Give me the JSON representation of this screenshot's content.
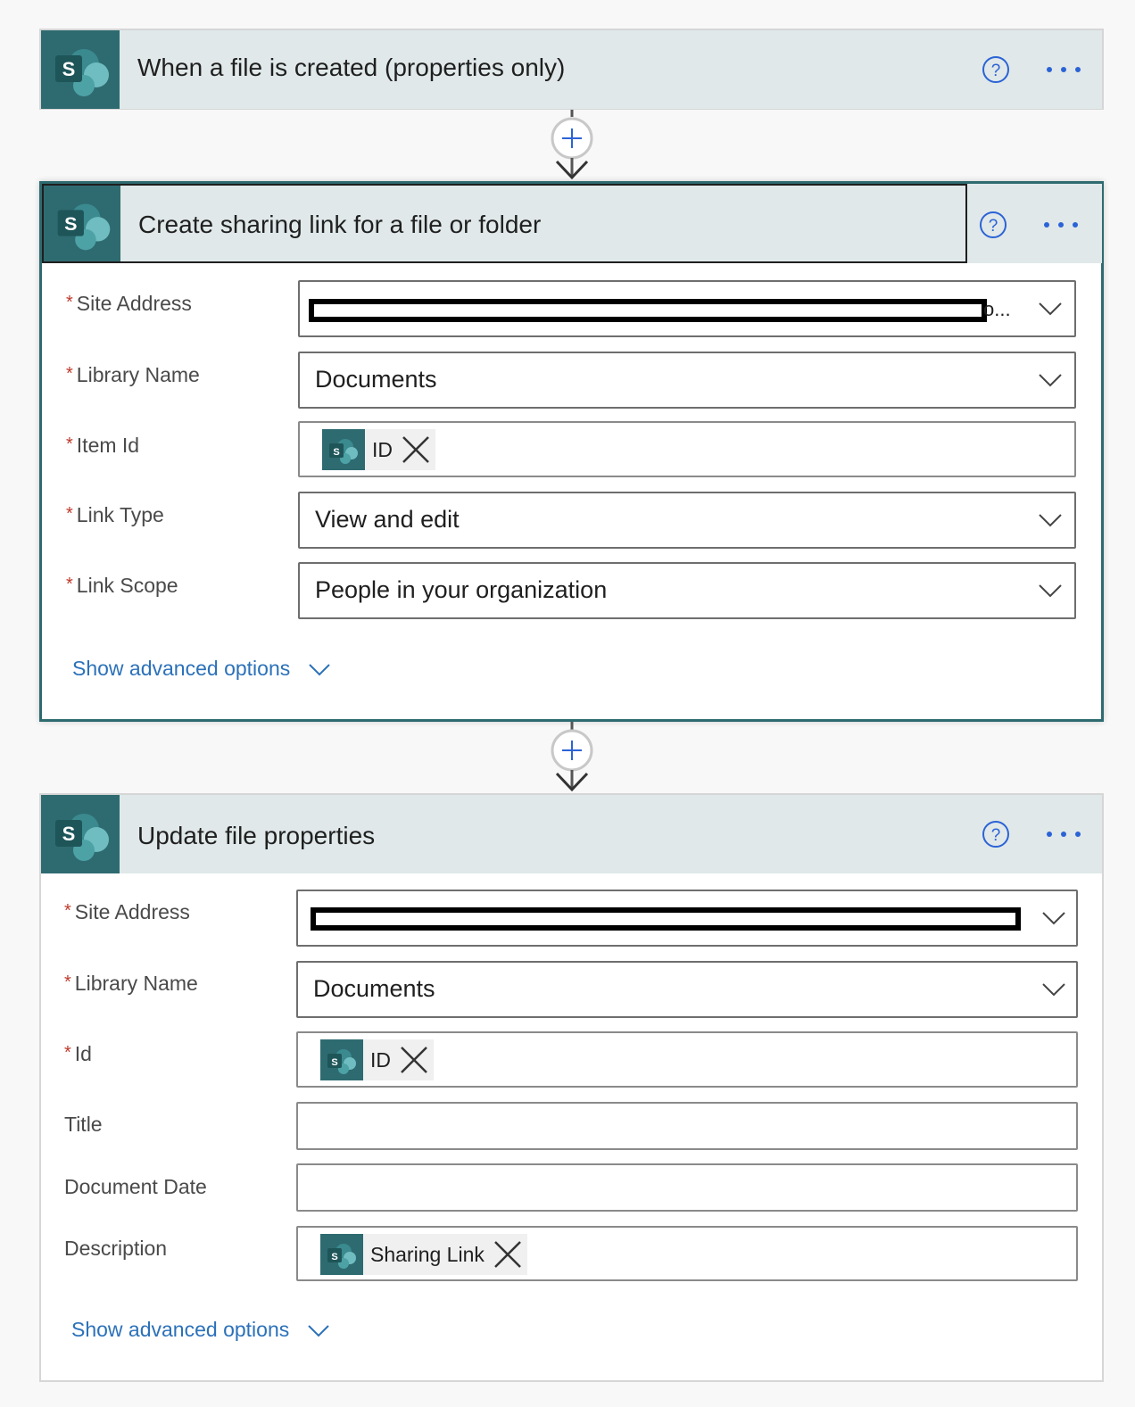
{
  "colors": {
    "sharepoint_tile": "#2e6b70",
    "header_bg": "#e0e8e9",
    "link": "#2b71b9",
    "required": "#c0392b",
    "help": "#2b63d6"
  },
  "trigger": {
    "title": "When a file is created (properties only)"
  },
  "action1": {
    "title": "Create sharing link for a file or folder",
    "fields": {
      "site_address": {
        "label": "Site Address",
        "value_trailing": "o..."
      },
      "library_name": {
        "label": "Library Name",
        "value": "Documents"
      },
      "item_id": {
        "label": "Item Id",
        "token": "ID"
      },
      "link_type": {
        "label": "Link Type",
        "value": "View and edit"
      },
      "link_scope": {
        "label": "Link Scope",
        "value": "People in your organization"
      }
    },
    "advanced_label": "Show advanced options"
  },
  "action2": {
    "title": "Update file properties",
    "fields": {
      "site_address": {
        "label": "Site Address"
      },
      "library_name": {
        "label": "Library Name",
        "value": "Documents"
      },
      "id": {
        "label": "Id",
        "token": "ID"
      },
      "title": {
        "label": "Title",
        "value": ""
      },
      "document_date": {
        "label": "Document Date",
        "value": ""
      },
      "description": {
        "label": "Description",
        "token": "Sharing Link"
      }
    },
    "advanced_label": "Show advanced options"
  },
  "required_marker": "*",
  "icons": [
    "sharepoint-icon",
    "help-icon",
    "more-icon",
    "add-step-icon",
    "arrow-down-icon",
    "chevron-down-icon",
    "remove-token-icon"
  ]
}
